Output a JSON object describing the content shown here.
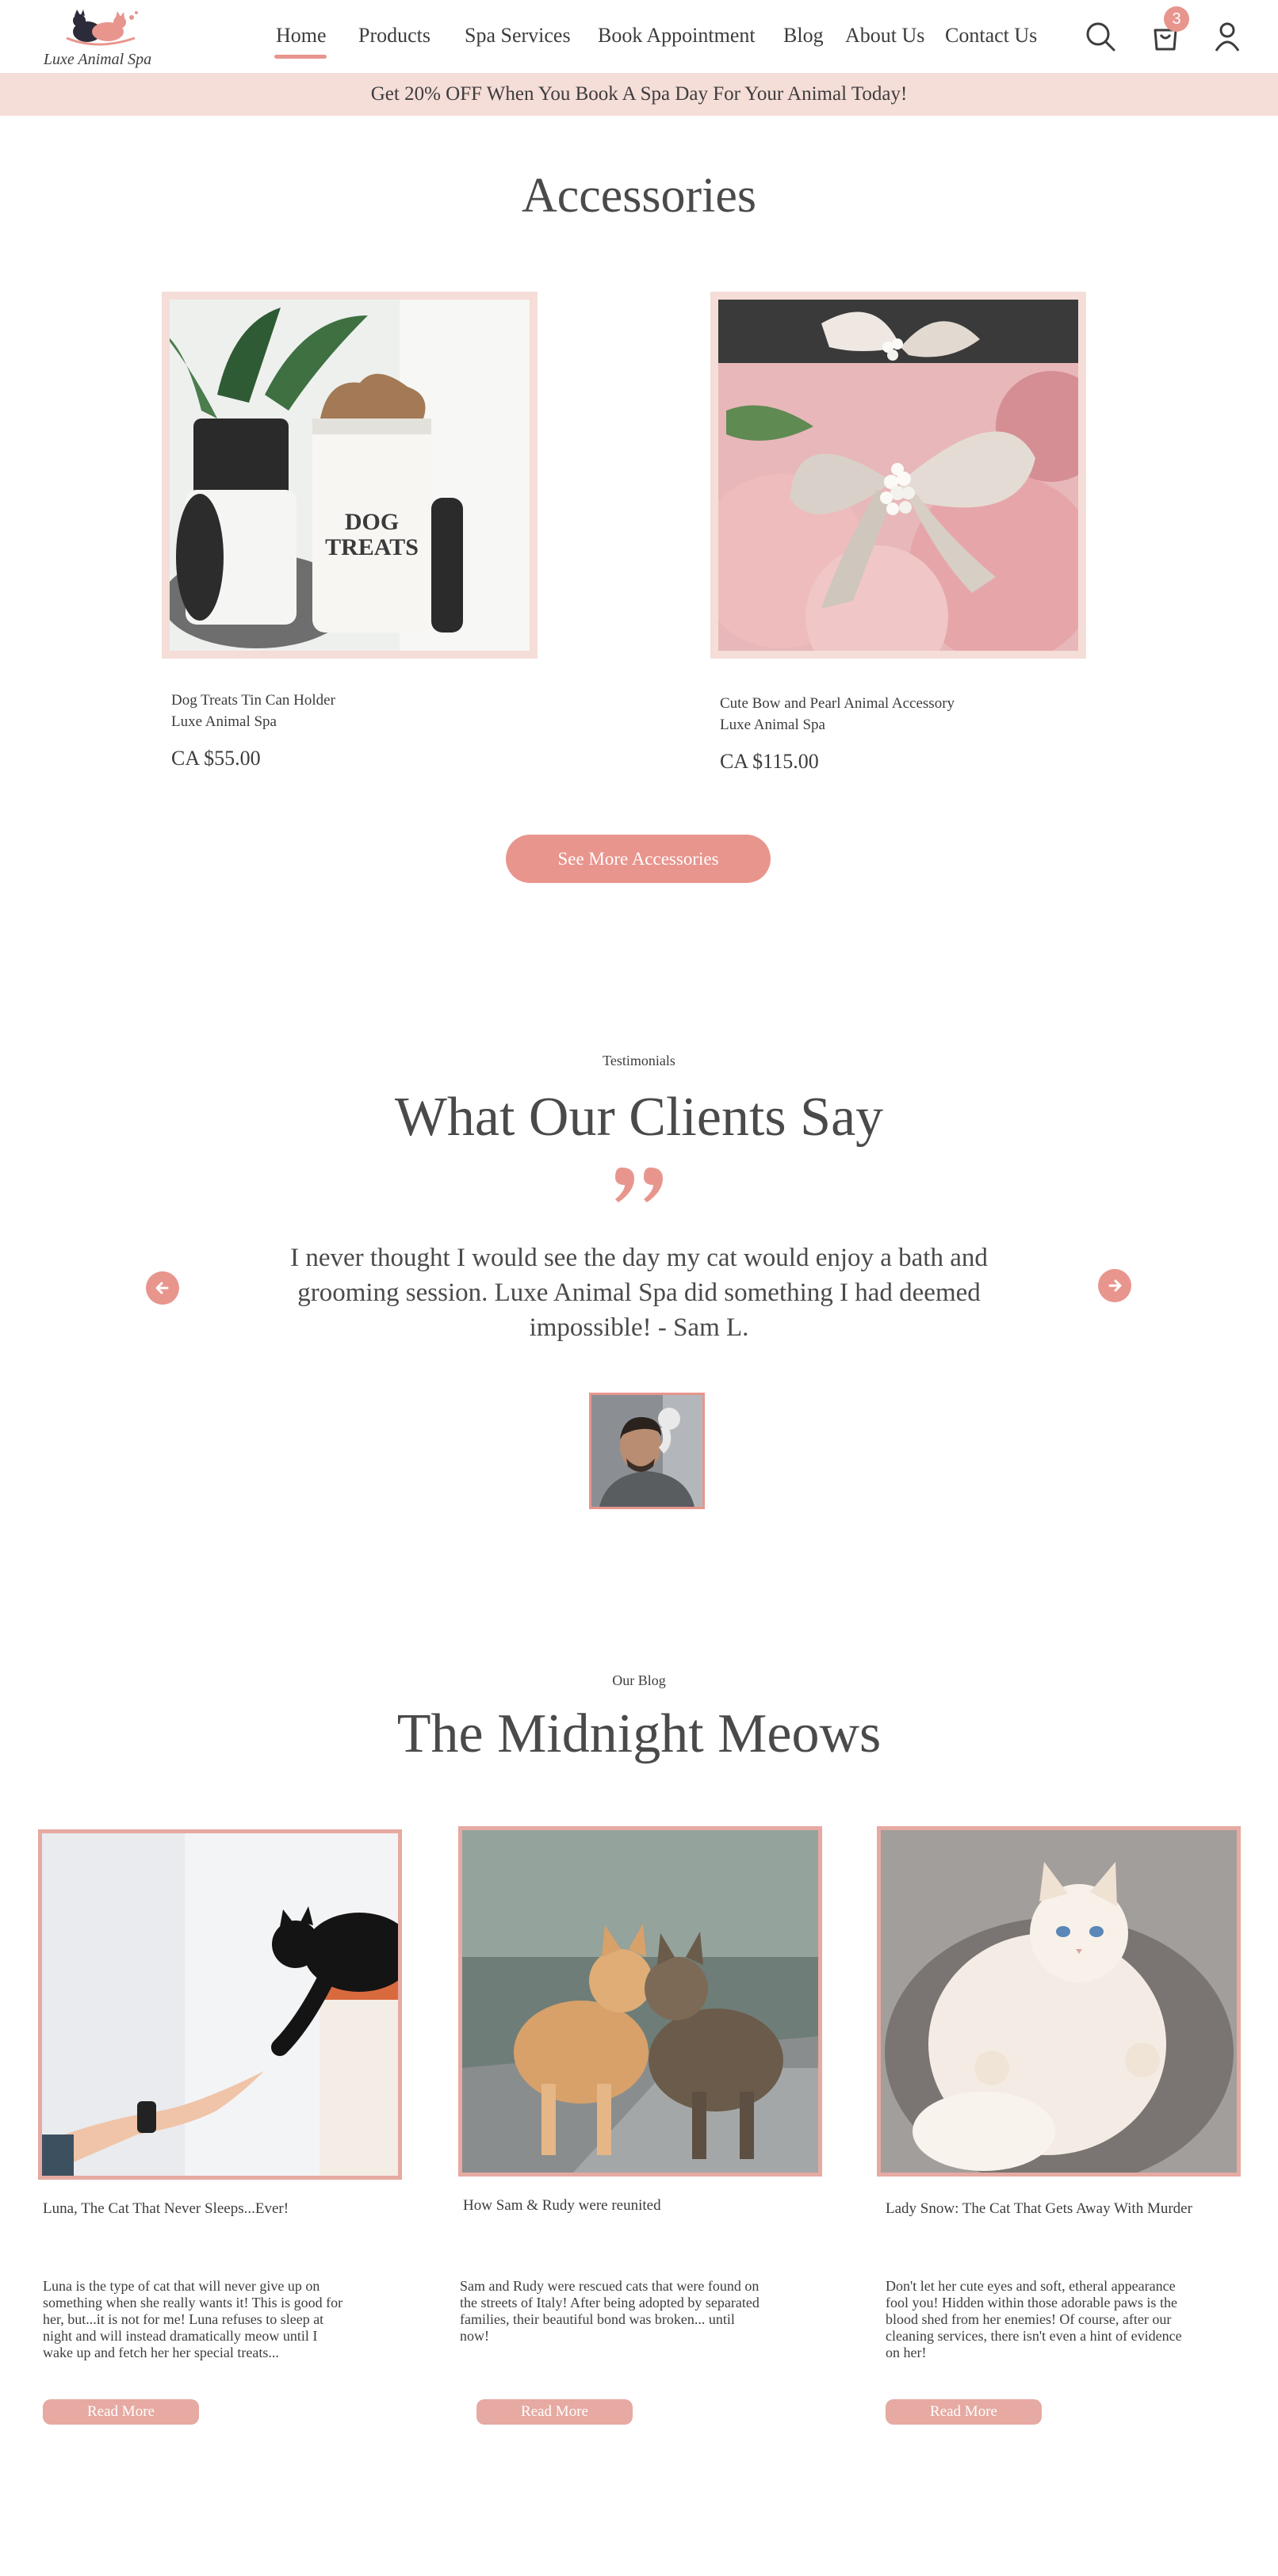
{
  "brand": {
    "logo_text": "Luxe Animal Spa"
  },
  "nav": {
    "items": [
      "Home",
      "Products",
      "Spa Services",
      "Book Appointment",
      "Blog",
      "About Us",
      "Contact Us"
    ],
    "active": "Home",
    "cart_count": "3",
    "icons": [
      "search-icon",
      "cart-icon",
      "account-icon"
    ]
  },
  "promo": {
    "text": "Get 20% OFF When You Book A Spa Day For Your Animal Today!"
  },
  "accessories": {
    "title": "Accessories",
    "products": [
      {
        "name": "Dog Treats Tin Can Holder",
        "vendor": "Luxe Animal Spa",
        "price": "CA $55.00",
        "image_text_line1": "DOG",
        "image_text_line2": "TREATS"
      },
      {
        "name": "Cute Bow and Pearl Animal Accessory",
        "vendor": "Luxe Animal Spa",
        "price": "CA $115.00"
      }
    ],
    "button_label": "See More Accessories"
  },
  "testimonials": {
    "label": "Testimonials",
    "title": "What Our Clients Say",
    "quote": "I never thought I would see the day my cat would enjoy a bath and grooming session. Luxe Animal Spa did something I had deemed impossible!   - Sam L."
  },
  "blog": {
    "label": "Our Blog",
    "title": "The Midnight Meows",
    "posts": [
      {
        "title": "Luna, The Cat That Never Sleeps...Ever!",
        "excerpt": "Luna is the type of cat that will never give up on something when she really wants it! This is good for her, but...it is not for me! Luna refuses to sleep at night and will instead dramatically meow until I wake up and fetch her her special treats...",
        "button": "Read More"
      },
      {
        "title": "How Sam & Rudy were reunited",
        "excerpt": "Sam and Rudy were rescued cats that were found on the streets of Italy! After being adopted by separated families, their beautiful bond was broken... until now!",
        "button": "Read More"
      },
      {
        "title": "Lady Snow: The Cat That Gets Away With Murder",
        "excerpt": "Don't let her cute eyes and soft, etheral appearance fool you! Hidden within those adorable paws is the blood shed from her enemies! Of course, after our cleaning services, there isn't even a hint of evidence on her!",
        "button": "Read More"
      }
    ]
  },
  "colors": {
    "accent": "#e8958d",
    "promo_bg": "#f5ddd8",
    "frame": "#f5ddd8",
    "blog_frame": "#e6aaa2",
    "text": "#4a4a4a"
  }
}
